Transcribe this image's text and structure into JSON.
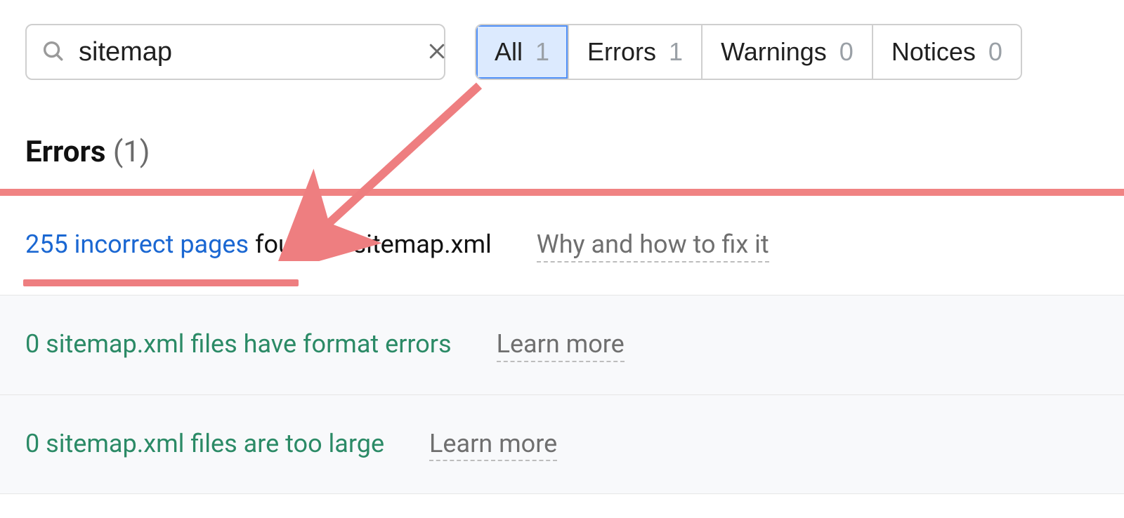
{
  "search": {
    "value": "sitemap"
  },
  "filters": [
    {
      "label": "All",
      "count": 1,
      "active": true
    },
    {
      "label": "Errors",
      "count": 1,
      "active": false
    },
    {
      "label": "Warnings",
      "count": 0,
      "active": false
    },
    {
      "label": "Notices",
      "count": 0,
      "active": false
    }
  ],
  "section": {
    "name": "Errors",
    "count_display": "(1)"
  },
  "issues": [
    {
      "link_text": "255 incorrect pages",
      "rest_text": " found in sitemap.xml",
      "help": "Why and how to fix it",
      "active": true
    },
    {
      "link_text": "",
      "rest_text": "0 sitemap.xml files have format errors",
      "help": "Learn more",
      "active": false
    },
    {
      "link_text": "",
      "rest_text": "0 sitemap.xml files are too large",
      "help": "Learn more",
      "active": false
    }
  ]
}
